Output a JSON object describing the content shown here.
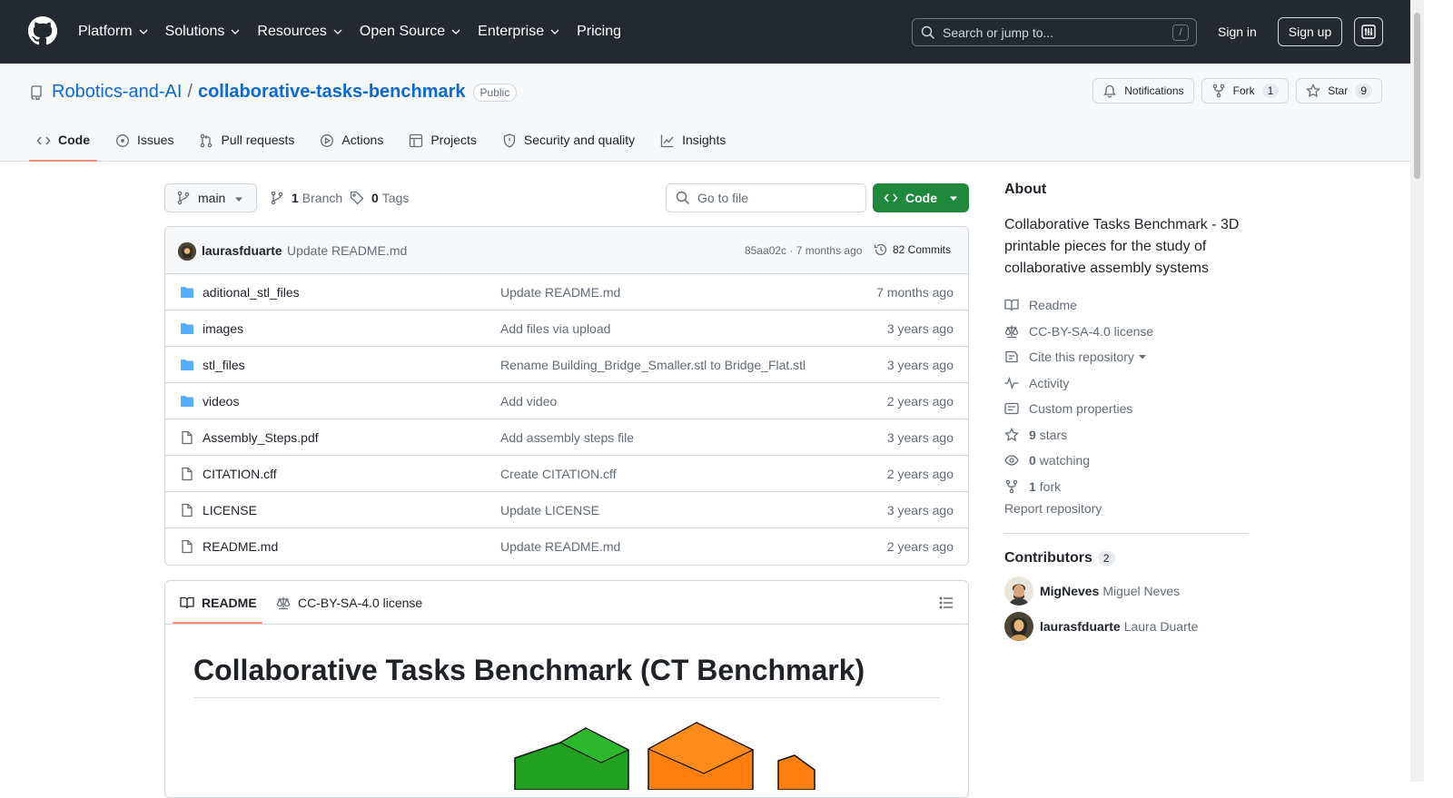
{
  "topnav": {
    "items": [
      {
        "label": "Platform",
        "has_menu": true
      },
      {
        "label": "Solutions",
        "has_menu": true
      },
      {
        "label": "Resources",
        "has_menu": true
      },
      {
        "label": "Open Source",
        "has_menu": true
      },
      {
        "label": "Enterprise",
        "has_menu": true
      },
      {
        "label": "Pricing",
        "has_menu": false
      }
    ],
    "search_placeholder": "Search or jump to...",
    "search_shortcut": "/",
    "signin": "Sign in",
    "signup": "Sign up"
  },
  "repo": {
    "owner": "Robotics-and-AI",
    "separator": "/",
    "name": "collaborative-tasks-benchmark",
    "visibility": "Public",
    "notifications": "Notifications",
    "fork_label": "Fork",
    "fork_count": "1",
    "star_label": "Star",
    "star_count": "9"
  },
  "tabs": [
    {
      "label": "Code",
      "icon": "code-icon",
      "active": true
    },
    {
      "label": "Issues",
      "icon": "issue-icon",
      "active": false
    },
    {
      "label": "Pull requests",
      "icon": "pull-request-icon",
      "active": false
    },
    {
      "label": "Actions",
      "icon": "play-icon",
      "active": false
    },
    {
      "label": "Projects",
      "icon": "table-icon",
      "active": false
    },
    {
      "label": "Security and quality",
      "icon": "shield-icon",
      "active": false
    },
    {
      "label": "Insights",
      "icon": "graph-icon",
      "active": false
    }
  ],
  "toolbar": {
    "branch": "main",
    "branch_count": "1",
    "branch_label": "Branch",
    "tag_count": "0",
    "tag_label": "Tags",
    "goto_placeholder": "Go to file",
    "code_button": "Code"
  },
  "commit": {
    "author": "laurasfduarte",
    "message": "Update README.md",
    "hash_time": "85aa02c · 7 months ago",
    "count": "82 Commits"
  },
  "files": [
    {
      "type": "dir",
      "name": "aditional_stl_files",
      "message": "Update README.md",
      "age": "7 months ago"
    },
    {
      "type": "dir",
      "name": "images",
      "message": "Add files via upload",
      "age": "3 years ago"
    },
    {
      "type": "dir",
      "name": "stl_files",
      "message": "Rename Building_Bridge_Smaller.stl to Bridge_Flat.stl",
      "age": "3 years ago"
    },
    {
      "type": "dir",
      "name": "videos",
      "message": "Add video",
      "age": "2 years ago"
    },
    {
      "type": "file",
      "name": "Assembly_Steps.pdf",
      "message": "Add assembly steps file",
      "age": "3 years ago"
    },
    {
      "type": "file",
      "name": "CITATION.cff",
      "message": "Create CITATION.cff",
      "age": "2 years ago"
    },
    {
      "type": "file",
      "name": "LICENSE",
      "message": "Update LICENSE",
      "age": "3 years ago"
    },
    {
      "type": "file",
      "name": "README.md",
      "message": "Update README.md",
      "age": "2 years ago"
    }
  ],
  "readme": {
    "tab_readme": "README",
    "tab_license": "CC-BY-SA-4.0 license",
    "heading": "Collaborative Tasks Benchmark (CT Benchmark)"
  },
  "about": {
    "heading": "About",
    "description": "Collaborative Tasks Benchmark - 3D printable pieces for the study of collaborative assembly systems",
    "readme": "Readme",
    "license": "CC-BY-SA-4.0 license",
    "cite": "Cite this repository",
    "activity": "Activity",
    "custom_properties": "Custom properties",
    "stars_count": "9",
    "stars_label": "stars",
    "watching_count": "0",
    "watching_label": "watching",
    "forks_count": "1",
    "forks_label": "fork",
    "report": "Report repository"
  },
  "contributors": {
    "heading": "Contributors",
    "count": "2",
    "list": [
      {
        "login": "MigNeves",
        "name": "Miguel Neves"
      },
      {
        "login": "laurasfduarte",
        "name": "Laura Duarte"
      }
    ]
  },
  "colors": {
    "header_bg": "#24292f",
    "link": "#0969da",
    "primary_button": "#1f883d",
    "folder": "#54aeff",
    "tab_underline": "#fd8c73"
  }
}
